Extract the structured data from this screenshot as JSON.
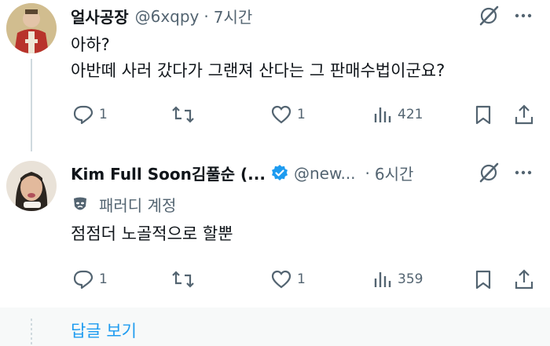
{
  "tweets": [
    {
      "display_name": "얼사공장",
      "handle": "@6xqpy",
      "separator": "·",
      "time": "7시간",
      "lines": [
        "아하?",
        "아반떼 사러 갔다가 그랜져 산다는 그 판매수법이군요?"
      ],
      "replies": "1",
      "retweets": "",
      "likes": "1",
      "views": "421"
    },
    {
      "display_name": "Kim Full Soon김풀순 (...",
      "handle": "@new...",
      "separator": "·",
      "time": "6시간",
      "label": "패러디 계정",
      "lines": [
        "점점더 노골적으로 할뿐"
      ],
      "replies": "1",
      "retweets": "",
      "likes": "1",
      "views": "359"
    }
  ],
  "show_replies": "답글 보기",
  "colors": {
    "text": "#0f1419",
    "muted": "#536471",
    "accent": "#1d9bf0",
    "verified": "#1d9bf0"
  }
}
